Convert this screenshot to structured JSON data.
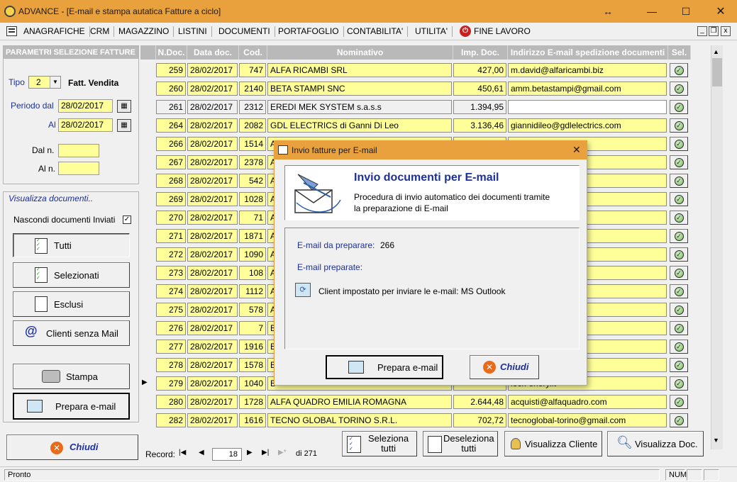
{
  "window": {
    "title": "ADVANCE - [E-mail e stampa autatica Fatture a ciclo]",
    "controls": {
      "resize": "↔",
      "minimize": "—",
      "maximize": "☐",
      "close": "✕"
    }
  },
  "menu": {
    "items": [
      "ANAGRAFICHE",
      "CRM",
      "MAGAZZINO",
      "LISTINI",
      "DOCUMENTI",
      "PORTAFOGLIO",
      "CONTABILITA'",
      "UTILITA'",
      "FINE LAVORO"
    ],
    "mdi_controls": {
      "minimize": "_",
      "restore": "❐",
      "close": "x"
    }
  },
  "left_panel": {
    "title": "PARAMETRI SELEZIONE FATTURE",
    "tipo_label": "Tipo",
    "tipo_value": "2",
    "tipo_desc": "Fatt. Vendita",
    "periodo_dal_label": "Periodo dal",
    "periodo_dal_value": "28/02/2017",
    "al_label": "Al",
    "al_value": "28/02/2017",
    "dal_n_label": "Dal n.",
    "al_n_label": "Al n.",
    "visualizza_title": "Visualizza documenti..",
    "nascondi_label": "Nascondi documenti Inviati",
    "btn_tutti": "Tutti",
    "btn_selezionati": "Selezionati",
    "btn_esclusi": "Esclusi",
    "btn_clienti": "Clienti senza Mail",
    "btn_stampa": "Stampa",
    "btn_prepara": "Prepara e-mail",
    "btn_chiudi": "Chiudi"
  },
  "grid": {
    "headers": [
      "N.Doc.",
      "Data doc.",
      "Cod.",
      "Nominativo",
      "Imp. Doc.",
      "Indirizzo E-mail spedizione documenti",
      "Sel."
    ],
    "rows": [
      {
        "ndoc": "259",
        "data": "28/02/2017",
        "cod": "747",
        "nom": "ALFA RICAMBI SRL",
        "imp": "427,00",
        "email": "m.david@alfaricambi.biz"
      },
      {
        "ndoc": "260",
        "data": "28/02/2017",
        "cod": "2140",
        "nom": "BETA STAMPI SNC",
        "imp": "450,61",
        "email": "amm.betastampi@gmail.com"
      },
      {
        "ndoc": "261",
        "data": "28/02/2017",
        "cod": "2312",
        "nom": "EREDI MEK SYSTEM s.a.s.s",
        "imp": "1.394,95",
        "email": ""
      },
      {
        "ndoc": "264",
        "data": "28/02/2017",
        "cod": "2082",
        "nom": "GDL ELECTRICS di Ganni Di Leo",
        "imp": "3.136,46",
        "email": "giannidileo@gdlelectrics.com"
      },
      {
        "ndoc": "266",
        "data": "28/02/2017",
        "cod": "1514",
        "nom": "A",
        "imp": "",
        "email": ".com"
      },
      {
        "ndoc": "267",
        "data": "28/02/2017",
        "cod": "2378",
        "nom": "A",
        "imp": "",
        "email": "il.com"
      },
      {
        "ndoc": "268",
        "data": "28/02/2017",
        "cod": "542",
        "nom": "A",
        "imp": "",
        "email": "iaggi.it"
      },
      {
        "ndoc": "269",
        "data": "28/02/2017",
        "cod": "1028",
        "nom": "A",
        "imp": "",
        "email": "one@abcitalia.eu"
      },
      {
        "ndoc": "270",
        "data": "28/02/2017",
        "cod": "71",
        "nom": "A",
        "imp": "",
        "email": "t"
      },
      {
        "ndoc": "271",
        "data": "28/02/2017",
        "cod": "1871",
        "nom": "A",
        "imp": "",
        "email": "@evolutions.com"
      },
      {
        "ndoc": "272",
        "data": "28/02/2017",
        "cod": "1090",
        "nom": "A",
        "imp": "",
        "email": "aborteck.it"
      },
      {
        "ndoc": "273",
        "data": "28/02/2017",
        "cod": "108",
        "nom": "A",
        "imp": "",
        "email": ""
      },
      {
        "ndoc": "274",
        "data": "28/02/2017",
        "cod": "1112",
        "nom": "A",
        "imp": "",
        "email": ""
      },
      {
        "ndoc": "275",
        "data": "28/02/2017",
        "cod": "578",
        "nom": "A",
        "imp": "",
        "email": "mattiaccio.com"
      },
      {
        "ndoc": "276",
        "data": "28/02/2017",
        "cod": "7",
        "nom": "B",
        "imp": "",
        "email": "mo.it"
      },
      {
        "ndoc": "277",
        "data": "28/02/2017",
        "cod": "1916",
        "nom": "B",
        "imp": "",
        "email": "m"
      },
      {
        "ndoc": "278",
        "data": "28/02/2017",
        "cod": "1578",
        "nom": "B",
        "imp": "",
        "email": "cainnocenzi.it"
      },
      {
        "ndoc": "279",
        "data": "28/02/2017",
        "cod": "1040",
        "nom": "B",
        "imp": "",
        "email": "lock-enery.it"
      },
      {
        "ndoc": "280",
        "data": "28/02/2017",
        "cod": "1728",
        "nom": "ALFA QUADRO EMILIA ROMAGNA",
        "imp": "2.644,48",
        "email": "acquisti@alfaquadro.com"
      },
      {
        "ndoc": "282",
        "data": "28/02/2017",
        "cod": "1616",
        "nom": "TECNO GLOBAL TORINO S.R.L.",
        "imp": "702,72",
        "email": "tecnoglobal-torino@gmail.com"
      }
    ]
  },
  "nav": {
    "record_label": "Record:",
    "record_value": "18",
    "of_label": "di 271",
    "first": "|◀",
    "prev": "◀",
    "next": "▶",
    "last": "▶|",
    "new": "▶*"
  },
  "toolbar": {
    "seleziona_1": "Seleziona",
    "seleziona_2": "tutti",
    "deseleziona_1": "Deseleziona",
    "deseleziona_2": "tutti",
    "visualizza_cliente": "Visualizza Cliente",
    "visualizza_doc": "Visualizza Doc."
  },
  "status": {
    "text": "Pronto",
    "num": "NUM"
  },
  "modal": {
    "title": "Invio fatture per E-mail",
    "heading": "Invio documenti per E-mail",
    "desc_1": "Procedura di invio automatico dei documenti tramite",
    "desc_2": "la preparazione di E-mail",
    "email_da_preparare_label": "E-mail da preparare:",
    "email_da_preparare_value": "266",
    "email_preparate_label": "E-mail preparate:",
    "client_text": "Client impostato per inviare le e-mail: MS Outlook",
    "btn_prepara": "Prepara e-mail",
    "btn_chiudi": "Chiudi",
    "close": "✕"
  },
  "colors": {
    "titlebar": "#e8a13c",
    "cell_yellow": "#ffff99",
    "label_blue": "#1c2f9c",
    "header_grey": "#b9b9b9"
  }
}
